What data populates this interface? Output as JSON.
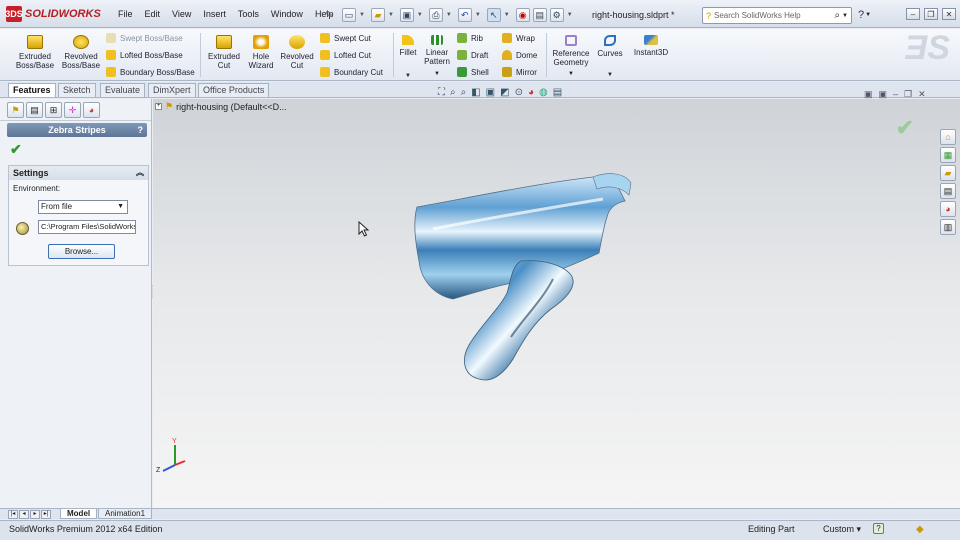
{
  "app": {
    "logo_badge": "3DS",
    "logo_text": "SOLIDWORKS",
    "doc_title": "right-housing.sldprt *"
  },
  "menu": [
    "File",
    "Edit",
    "View",
    "Insert",
    "Tools",
    "Window",
    "Help"
  ],
  "search": {
    "placeholder": "Search SolidWorks Help"
  },
  "window_controls": {
    "minimize": "–",
    "restore": "❐",
    "close": "✕"
  },
  "command_manager": {
    "extruded_boss": "Extruded Boss/Base",
    "revolved_boss": "Revolved Boss/Base",
    "swept_boss": "Swept Boss/Base",
    "lofted_boss": "Lofted Boss/Base",
    "boundary_boss": "Boundary Boss/Base",
    "extruded_cut": "Extruded Cut",
    "hole_wizard": "Hole Wizard",
    "revolved_cut": "Revolved Cut",
    "swept_cut": "Swept Cut",
    "lofted_cut": "Lofted Cut",
    "boundary_cut": "Boundary Cut",
    "fillet": "Fillet",
    "linear_pattern": "Linear Pattern",
    "rib": "Rib",
    "draft": "Draft",
    "shell": "Shell",
    "wrap": "Wrap",
    "dome": "Dome",
    "mirror": "Mirror",
    "reference_geometry": "Reference Geometry",
    "curves": "Curves",
    "instant3d": "Instant3D"
  },
  "tabs": [
    "Features",
    "Sketch",
    "Evaluate",
    "DimXpert",
    "Office Products"
  ],
  "active_tab": "Features",
  "property_manager": {
    "title": "Zebra Stripes",
    "help": "?",
    "ok": "✔",
    "settings_header": "Settings",
    "environment_label": "Environment:",
    "environment_value": "From file",
    "path_value": "C:\\Program Files\\SolidWorks",
    "browse_label": "Browse..."
  },
  "viewport": {
    "tree_item": "right-housing  (Default<<D...",
    "confirm": "✔"
  },
  "bottom_tabs": [
    "Model",
    "Animation1"
  ],
  "status": {
    "edition": "SolidWorks Premium 2012 x64 Edition",
    "mode": "Editing Part",
    "units": "Custom",
    "units_arrow": "▾",
    "help_icon": "?"
  },
  "colors": {
    "brand": "#b51d24",
    "accent": "#5d7697",
    "ok_green": "#2e9b2e"
  }
}
